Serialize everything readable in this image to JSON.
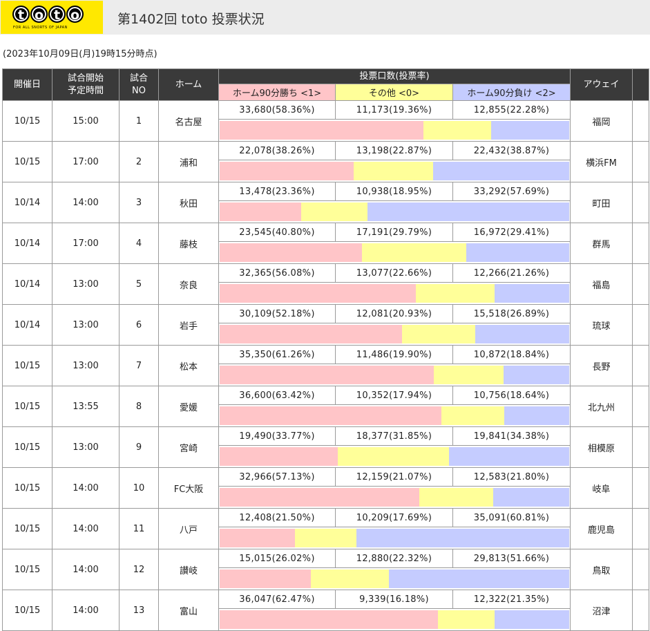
{
  "logo": {
    "letters": [
      "t",
      "o",
      "t",
      "o"
    ],
    "tagline": "FOR ALL SNORTS OF JAPAN"
  },
  "title": "第1402回 toto 投票状況",
  "timestamp": "(2023年10月09日(月)19時15分時点)",
  "table": {
    "headers": {
      "date": "開催日",
      "time_line1": "試合開始",
      "time_line2": "予定時間",
      "no_line1": "試合",
      "no_line2": "NO",
      "home": "ホーム",
      "votes": "投票口数(投票率)",
      "away": "アウェイ",
      "win": "ホーム90分勝ち <1>",
      "other": "その他 <0>",
      "lose": "ホーム90分負け <2>"
    },
    "colors": {
      "header_bg": "#3a3a3a",
      "home_win": "#ffc5c8",
      "other": "#ffff99",
      "home_lose": "#c5ccff"
    },
    "rows": [
      {
        "date": "10/15",
        "time": "15:00",
        "no": "1",
        "home": "名古屋",
        "away": "福岡",
        "win": "33,680(58.36%)",
        "other": "11,173(19.36%)",
        "lose": "12,855(22.28%)",
        "win_pct": 58.36,
        "other_pct": 19.36,
        "lose_pct": 22.28
      },
      {
        "date": "10/15",
        "time": "17:00",
        "no": "2",
        "home": "浦和",
        "away": "横浜FM",
        "win": "22,078(38.26%)",
        "other": "13,198(22.87%)",
        "lose": "22,432(38.87%)",
        "win_pct": 38.26,
        "other_pct": 22.87,
        "lose_pct": 38.87
      },
      {
        "date": "10/14",
        "time": "14:00",
        "no": "3",
        "home": "秋田",
        "away": "町田",
        "win": "13,478(23.36%)",
        "other": "10,938(18.95%)",
        "lose": "33,292(57.69%)",
        "win_pct": 23.36,
        "other_pct": 18.95,
        "lose_pct": 57.69
      },
      {
        "date": "10/14",
        "time": "17:00",
        "no": "4",
        "home": "藤枝",
        "away": "群馬",
        "win": "23,545(40.80%)",
        "other": "17,191(29.79%)",
        "lose": "16,972(29.41%)",
        "win_pct": 40.8,
        "other_pct": 29.79,
        "lose_pct": 29.41
      },
      {
        "date": "10/14",
        "time": "13:00",
        "no": "5",
        "home": "奈良",
        "away": "福島",
        "win": "32,365(56.08%)",
        "other": "13,077(22.66%)",
        "lose": "12,266(21.26%)",
        "win_pct": 56.08,
        "other_pct": 22.66,
        "lose_pct": 21.26
      },
      {
        "date": "10/14",
        "time": "13:00",
        "no": "6",
        "home": "岩手",
        "away": "琉球",
        "win": "30,109(52.18%)",
        "other": "12,081(20.93%)",
        "lose": "15,518(26.89%)",
        "win_pct": 52.18,
        "other_pct": 20.93,
        "lose_pct": 26.89
      },
      {
        "date": "10/15",
        "time": "13:00",
        "no": "7",
        "home": "松本",
        "away": "長野",
        "win": "35,350(61.26%)",
        "other": "11,486(19.90%)",
        "lose": "10,872(18.84%)",
        "win_pct": 61.26,
        "other_pct": 19.9,
        "lose_pct": 18.84
      },
      {
        "date": "10/15",
        "time": "13:55",
        "no": "8",
        "home": "愛媛",
        "away": "北九州",
        "win": "36,600(63.42%)",
        "other": "10,352(17.94%)",
        "lose": "10,756(18.64%)",
        "win_pct": 63.42,
        "other_pct": 17.94,
        "lose_pct": 18.64
      },
      {
        "date": "10/15",
        "time": "13:00",
        "no": "9",
        "home": "宮崎",
        "away": "相模原",
        "win": "19,490(33.77%)",
        "other": "18,377(31.85%)",
        "lose": "19,841(34.38%)",
        "win_pct": 33.77,
        "other_pct": 31.85,
        "lose_pct": 34.38
      },
      {
        "date": "10/15",
        "time": "14:00",
        "no": "10",
        "home": "FC大阪",
        "away": "岐阜",
        "win": "32,966(57.13%)",
        "other": "12,159(21.07%)",
        "lose": "12,583(21.80%)",
        "win_pct": 57.13,
        "other_pct": 21.07,
        "lose_pct": 21.8
      },
      {
        "date": "10/15",
        "time": "14:00",
        "no": "11",
        "home": "八戸",
        "away": "鹿児島",
        "win": "12,408(21.50%)",
        "other": "10,209(17.69%)",
        "lose": "35,091(60.81%)",
        "win_pct": 21.5,
        "other_pct": 17.69,
        "lose_pct": 60.81
      },
      {
        "date": "10/15",
        "time": "14:00",
        "no": "12",
        "home": "讃岐",
        "away": "鳥取",
        "win": "15,015(26.02%)",
        "other": "12,880(22.32%)",
        "lose": "29,813(51.66%)",
        "win_pct": 26.02,
        "other_pct": 22.32,
        "lose_pct": 51.66
      },
      {
        "date": "10/15",
        "time": "14:00",
        "no": "13",
        "home": "富山",
        "away": "沼津",
        "win": "36,047(62.47%)",
        "other": "9,339(16.18%)",
        "lose": "12,322(21.35%)",
        "win_pct": 62.47,
        "other_pct": 16.18,
        "lose_pct": 21.35
      }
    ]
  }
}
